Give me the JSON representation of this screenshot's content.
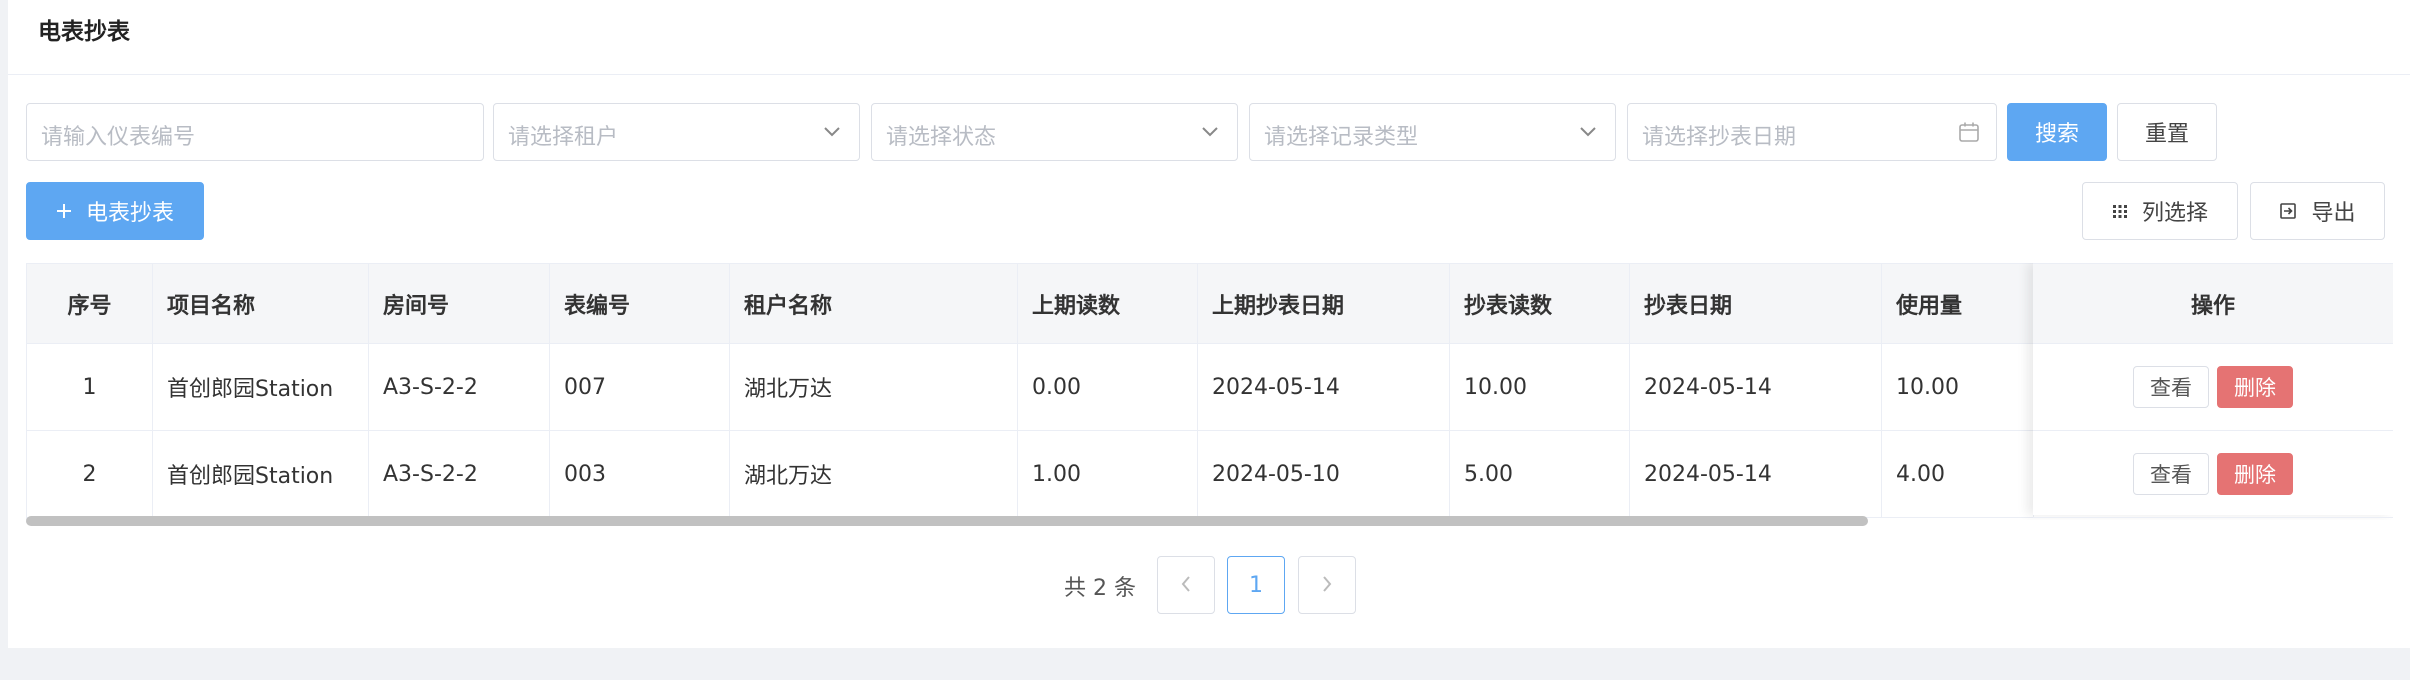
{
  "header": {
    "title": "电表抄表"
  },
  "filters": {
    "meter_no_placeholder": "请输入仪表编号",
    "tenant_placeholder": "请选择租户",
    "status_placeholder": "请选择状态",
    "record_type_placeholder": "请选择记录类型",
    "date_placeholder": "请选择抄表日期",
    "search_label": "搜索",
    "reset_label": "重置"
  },
  "toolbar": {
    "add_label": "电表抄表",
    "columns_label": "列选择",
    "export_label": "导出"
  },
  "table": {
    "columns": [
      "序号",
      "项目名称",
      "房间号",
      "表编号",
      "租户名称",
      "上期读数",
      "上期抄表日期",
      "抄表读数",
      "抄表日期",
      "使用量",
      "操作"
    ],
    "rows": [
      {
        "index": "1",
        "project": "首创郎园Station",
        "room": "A3-S-2-2",
        "meter": "007",
        "tenant": "湖北万达",
        "prev_reading": "0.00",
        "prev_date": "2024-05-14",
        "reading": "10.00",
        "date": "2024-05-14",
        "usage": "10.00"
      },
      {
        "index": "2",
        "project": "首创郎园Station",
        "room": "A3-S-2-2",
        "meter": "003",
        "tenant": "湖北万达",
        "prev_reading": "1.00",
        "prev_date": "2024-05-10",
        "reading": "5.00",
        "date": "2024-05-14",
        "usage": "4.00"
      }
    ],
    "view_label": "查看",
    "delete_label": "删除"
  },
  "pagination": {
    "total_text": "共 2 条",
    "current_page": "1"
  },
  "colors": {
    "primary": "#5ea7f2",
    "danger": "#e57373",
    "border": "#dcdfe6"
  },
  "icons": [
    "plus-icon",
    "chevron-down-icon",
    "calendar-icon",
    "grid-icon",
    "export-icon",
    "chevron-left-icon",
    "chevron-right-icon"
  ]
}
